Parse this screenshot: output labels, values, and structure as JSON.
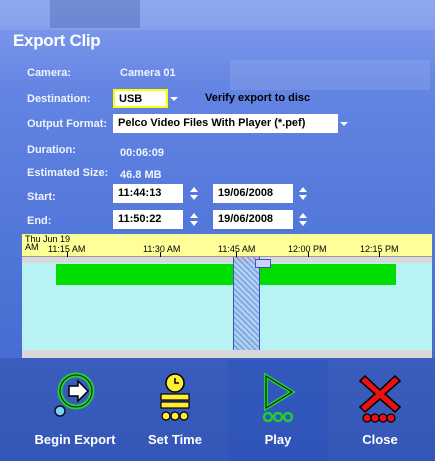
{
  "dialog": {
    "title": "Export Clip"
  },
  "fields": {
    "camera_label": "Camera:",
    "camera_value": "Camera 01",
    "destination_label": "Destination:",
    "destination_value": "USB",
    "verify_label": "Verify export to disc",
    "output_format_label": "Output Format:",
    "output_format_value": "Pelco Video Files With Player (*.pef)",
    "duration_label": "Duration:",
    "duration_value": "00:06:09",
    "size_label": "Estimated Size:",
    "size_value": "46.8 MB",
    "start_label": "Start:",
    "start_time": "11:44:13",
    "start_date": "19/06/2008",
    "end_label": "End:",
    "end_time": "11:50:22",
    "end_date": "19/06/2008"
  },
  "timeline": {
    "date_line1": "Thu Jun 19",
    "date_line2": "AM",
    "ticks": [
      "11:15 AM",
      "11:30 AM",
      "11:45 AM",
      "12:00 PM",
      "12:15 PM"
    ]
  },
  "buttons": {
    "begin_export": "Begin Export",
    "set_time": "Set Time",
    "play": "Play",
    "close": "Close"
  },
  "colors": {
    "recording": "#00dd00",
    "timeline_bg": "#b8f2f2",
    "ruler_bg": "#ffff99",
    "destination_highlight": "#ffff00"
  }
}
